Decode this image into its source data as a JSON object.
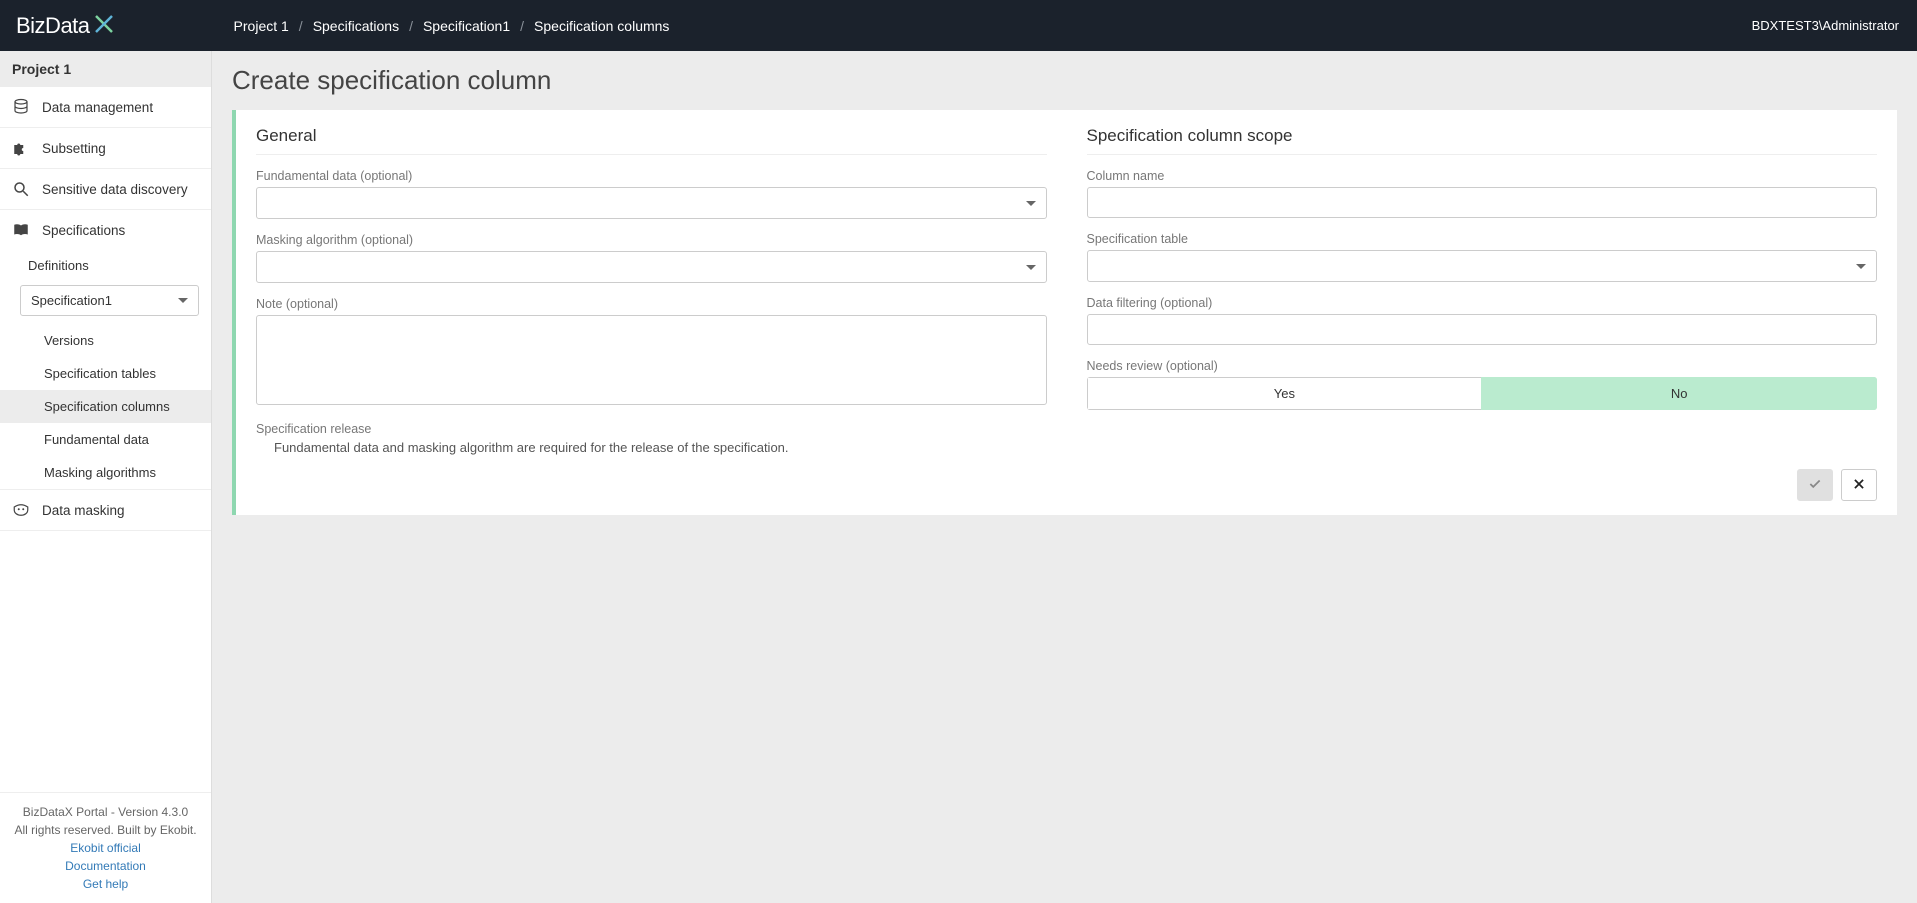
{
  "header": {
    "logo_text": "BizData",
    "user": "BDXTEST3\\Administrator"
  },
  "breadcrumb": {
    "items": [
      "Project 1",
      "Specifications",
      "Specification1",
      "Specification columns"
    ]
  },
  "sidebar": {
    "project": "Project 1",
    "nav": {
      "data_management": "Data management",
      "subsetting": "Subsetting",
      "sensitive_discovery": "Sensitive data discovery",
      "specifications": "Specifications",
      "data_masking": "Data masking"
    },
    "spec_nav": {
      "definitions": "Definitions",
      "selected_spec": "Specification1",
      "items": {
        "versions": "Versions",
        "tables": "Specification tables",
        "columns": "Specification columns",
        "fundamental": "Fundamental data",
        "masking_alg": "Masking algorithms"
      }
    },
    "footer": {
      "line1": "BizDataX Portal - Version 4.3.0",
      "line2": "All rights reserved. Built by Ekobit.",
      "link1": "Ekobit official",
      "link2": "Documentation",
      "link3": "Get help"
    }
  },
  "page": {
    "title": "Create specification column",
    "general": {
      "heading": "General",
      "fundamental_label": "Fundamental data (optional)",
      "masking_label": "Masking algorithm (optional)",
      "note_label": "Note (optional)",
      "release_label": "Specification release",
      "release_text": "Fundamental data and masking algorithm are required for the release of the specification."
    },
    "scope": {
      "heading": "Specification column scope",
      "column_label": "Column name",
      "table_label": "Specification table",
      "filter_label": "Data filtering (optional)",
      "review_label": "Needs review (optional)",
      "yes": "Yes",
      "no": "No"
    }
  }
}
